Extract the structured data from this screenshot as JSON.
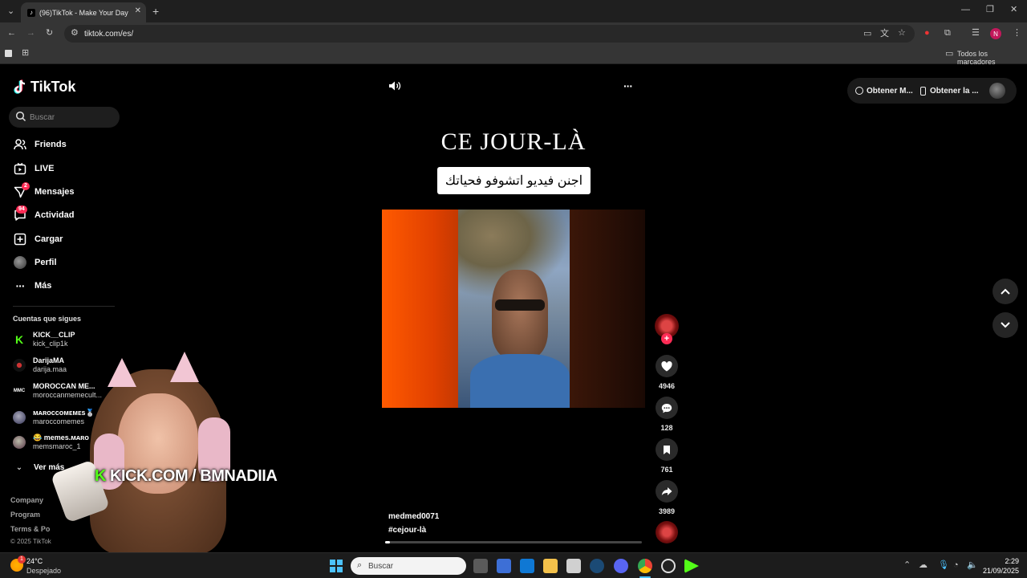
{
  "browser": {
    "tab_title": "(96)TikTok - Make Your Day",
    "url": "tiktok.com/es/",
    "bookmarks_label": "Todos los marcadores",
    "profile_initial": "N"
  },
  "sidebar": {
    "logo": "TikTok",
    "search_placeholder": "Buscar",
    "nav": [
      {
        "label": "Friends",
        "icon": "friends-icon"
      },
      {
        "label": "LIVE",
        "icon": "live-icon"
      },
      {
        "label": "Mensajes",
        "icon": "messages-icon",
        "badge": "2"
      },
      {
        "label": "Actividad",
        "icon": "activity-icon",
        "badge": "94"
      },
      {
        "label": "Cargar",
        "icon": "upload-icon"
      },
      {
        "label": "Perfil",
        "icon": "avatar"
      },
      {
        "label": "Más",
        "icon": "more-icon"
      }
    ],
    "following_title": "Cuentas que sigues",
    "accounts": [
      {
        "name": "KICK__CLIP",
        "handle": "kick_clip1k"
      },
      {
        "name": "DarijaMA",
        "handle": "darija.maa"
      },
      {
        "name": "MOROCCAN ME...",
        "handle": "moroccanmemecult..."
      },
      {
        "name": "ᴍᴀʀᴏᴄᴄᴏᴍᴇᴍᴇs🥈",
        "handle": "maroccomemes"
      },
      {
        "name": "😂 memes.ᴍᴀʀᴏ",
        "handle": "memsmaroc_1"
      }
    ],
    "see_more": "Ver más",
    "footer": [
      "Company",
      "Program",
      "Terms & Po",
      "© 2025 TikTok"
    ]
  },
  "top": {
    "get_app_1": "Obtener M...",
    "get_app_2": "Obtener la ..."
  },
  "video": {
    "title": "CE JOUR-LÀ",
    "caption": "اجنن فيديو اتشوفو فحياتك",
    "username": "medmed0071",
    "hashtag": "#cejour-là",
    "likes": "4946",
    "comments": "128",
    "saves": "761",
    "shares": "3989",
    "progress": 0.02
  },
  "overlay": {
    "kick_k": "K",
    "kick_text": "KICK.COM / BMNADIIA"
  },
  "taskbar": {
    "weather_temp": "24°C",
    "weather_desc": "Despejado",
    "search": "Buscar",
    "time": "2:29",
    "date": "21/09/2025",
    "notif_badge": "1"
  },
  "colors": {
    "accent": "#fe2c55",
    "kick_green": "#53fc18"
  }
}
